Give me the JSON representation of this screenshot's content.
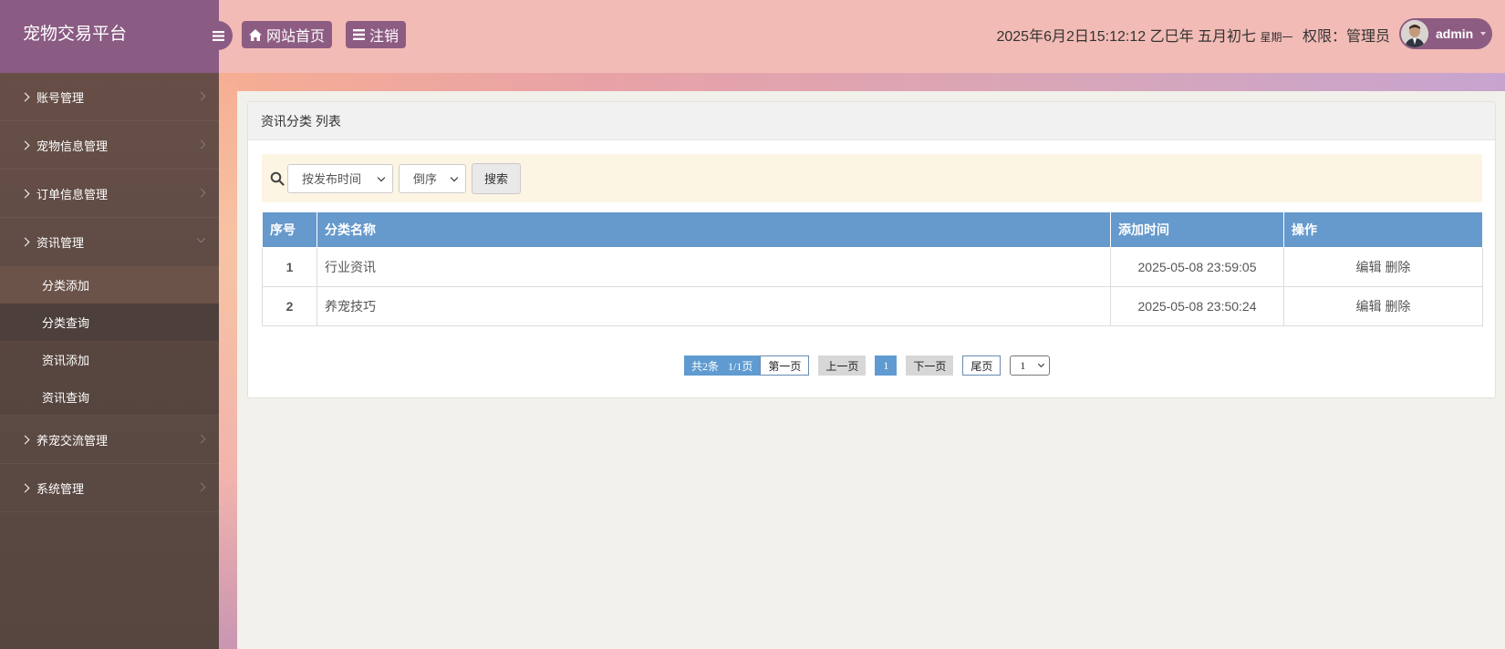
{
  "brand": {
    "title": "宠物交易平台"
  },
  "header": {
    "home_label": "网站首页",
    "logout_label": "注销",
    "datetime": "2025年6月2日15:12:12 乙巳年 五月初七",
    "weekday": "星期一",
    "role_text": "权限：管理员",
    "username": "admin"
  },
  "sidebar": {
    "items": [
      {
        "label": "账号管理"
      },
      {
        "label": "宠物信息管理"
      },
      {
        "label": "订单信息管理"
      },
      {
        "label": "资讯管理"
      },
      {
        "label": "养宠交流管理"
      },
      {
        "label": "系统管理"
      }
    ],
    "sub_items": [
      {
        "label": "分类添加"
      },
      {
        "label": "分类查询"
      },
      {
        "label": "资讯添加"
      },
      {
        "label": "资讯查询"
      }
    ]
  },
  "panel": {
    "title": "资讯分类 列表"
  },
  "search": {
    "sort_field": "按发布时间",
    "sort_order": "倒序",
    "button_label": "搜索"
  },
  "table": {
    "headers": [
      "序号",
      "分类名称",
      "添加时间",
      "操作"
    ],
    "rows": [
      {
        "num": "1",
        "name": "行业资讯",
        "time": "2025-05-08 23:59:05",
        "edit": "编辑",
        "delete": "删除"
      },
      {
        "num": "2",
        "name": "养宠技巧",
        "time": "2025-05-08 23:50:24",
        "edit": "编辑",
        "delete": "删除"
      }
    ]
  },
  "pager": {
    "total": "共2条",
    "pages": "1/1页",
    "first": "第一页",
    "prev": "上一页",
    "current": "1",
    "next": "下一页",
    "last": "尾页",
    "jump_value": "1"
  },
  "colors": {
    "brand_bg": "#8a5b83",
    "header_bg": "#f2bbb5",
    "table_header": "#6699cc",
    "search_bg": "#fdf5e3"
  },
  "icons": {
    "toggle": "bars-icon",
    "home": "home-icon",
    "logout": "list-icon",
    "search": "search-icon"
  }
}
